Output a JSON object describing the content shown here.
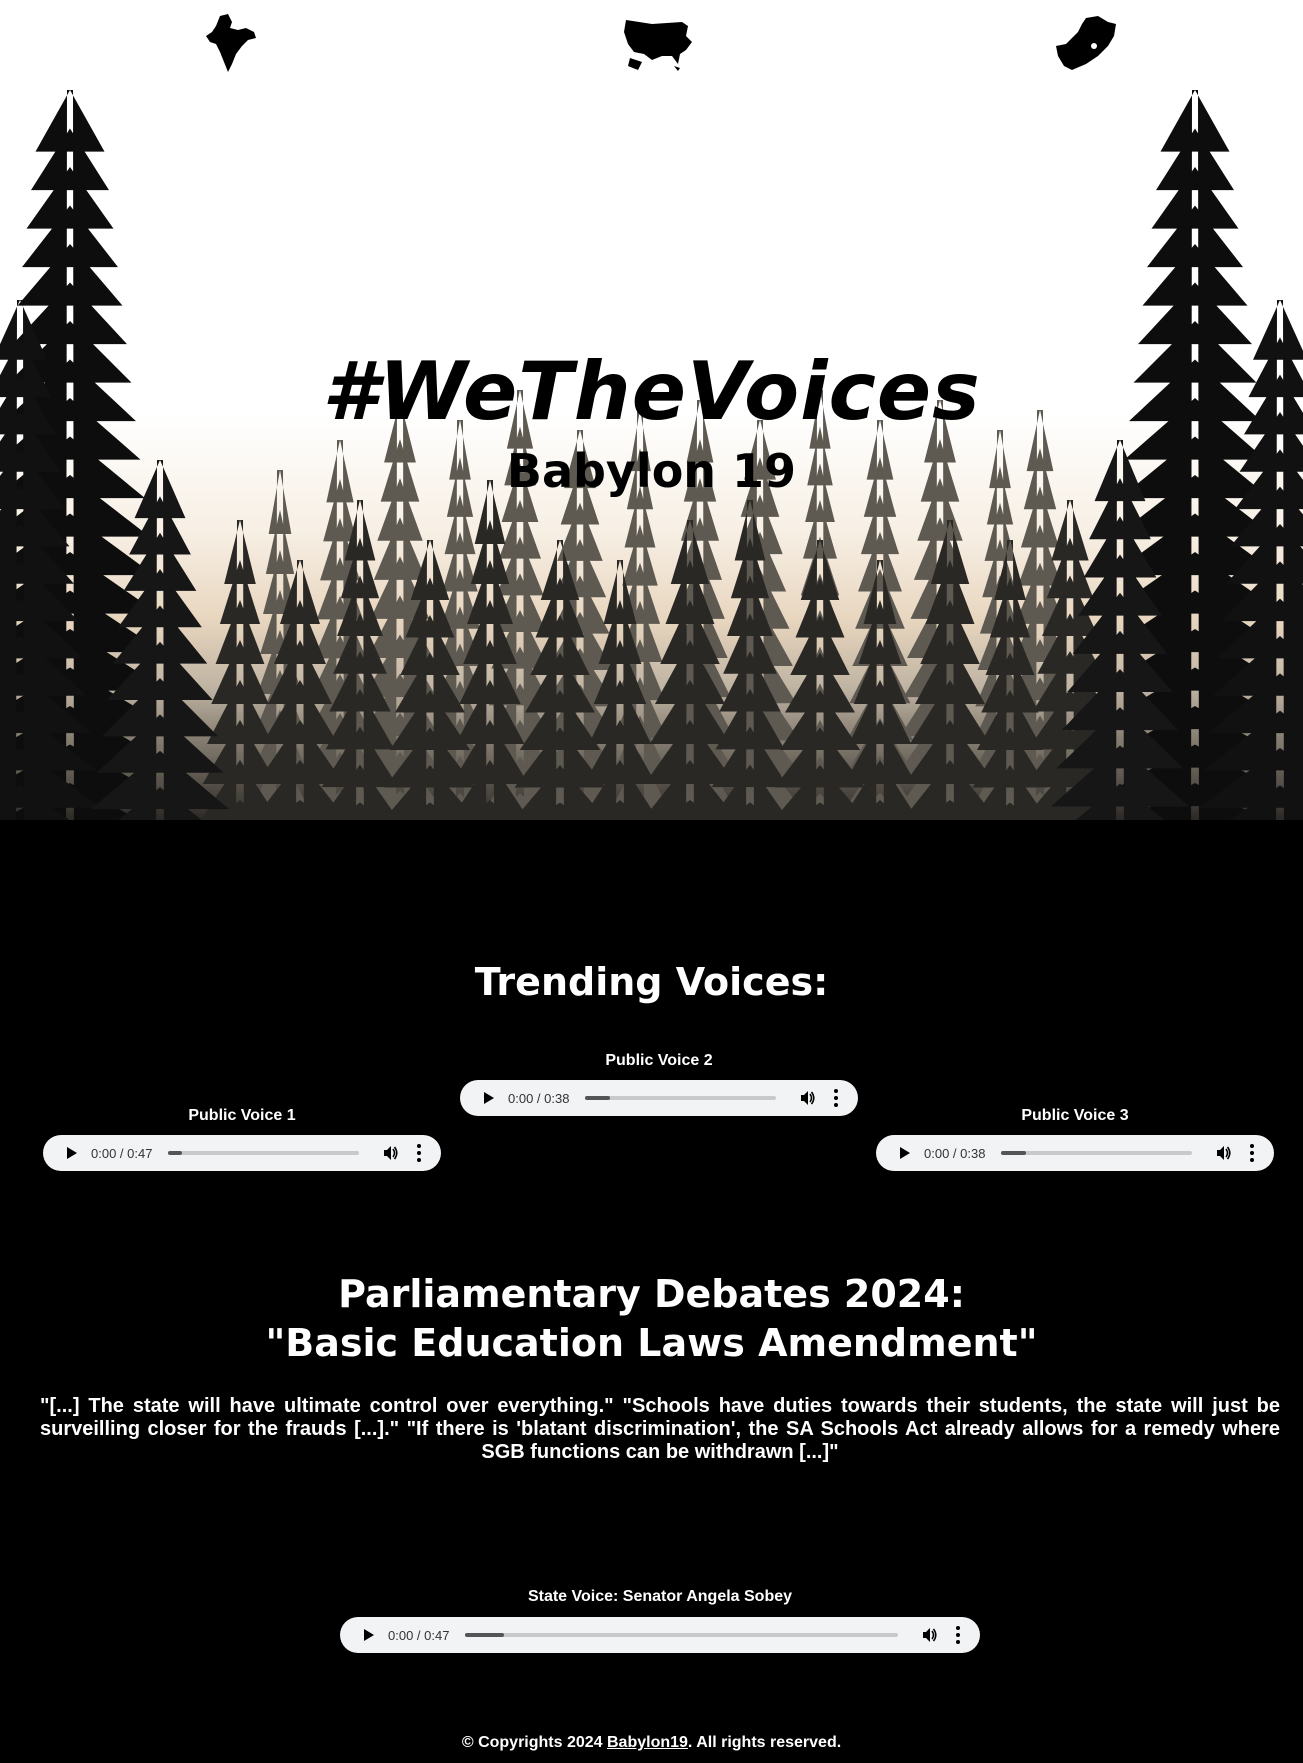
{
  "hero": {
    "title": "#WeTheVoices",
    "subtitle": "Babylon 19",
    "map_icons": [
      "india-map-icon",
      "usa-map-icon",
      "south-africa-map-icon"
    ]
  },
  "trending": {
    "heading": "Trending Voices:",
    "voices": [
      {
        "label": "Public Voice 1",
        "current": "0:00",
        "duration": "0:47",
        "progress": 0.07
      },
      {
        "label": "Public Voice 2",
        "current": "0:00",
        "duration": "0:38",
        "progress": 0.13
      },
      {
        "label": "Public Voice 3",
        "current": "0:00",
        "duration": "0:38",
        "progress": 0.13
      }
    ]
  },
  "debate": {
    "heading_line1": "Parliamentary Debates 2024:",
    "heading_line2": "\"Basic Education Laws Amendment\"",
    "quotes": [
      "\"[...] The state will have ultimate control over everything.\"",
      "\"Schools have duties towards their students, the state will just be surveilling closer for the frauds [...].\"",
      "\"If there is 'blatant discrimination', the SA Schools Act already allows for a remedy where SGB functions can be withdrawn [...]\""
    ]
  },
  "state_voice": {
    "label": "State Voice: Senator Angela Sobey",
    "current": "0:00",
    "duration": "0:47",
    "progress": 0.09
  },
  "footer": {
    "prefix": "© Copyrights 2024 ",
    "link": "Babylon19",
    "suffix": ". All rights reserved."
  },
  "colors": {
    "background": "#000000",
    "player_bg": "#f1f3f4",
    "text": "#ffffff"
  }
}
